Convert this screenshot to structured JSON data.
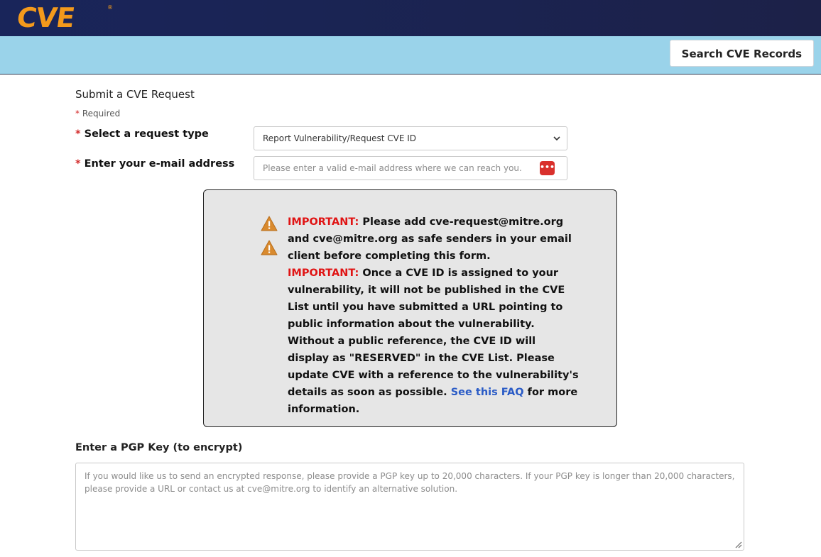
{
  "header": {
    "logo_text": "CVE",
    "logo_mark": "®",
    "brand_color": "#f39a1c",
    "search_button_label": "Search CVE Records"
  },
  "form": {
    "title": "Submit a CVE Request",
    "required_mark": "*",
    "required_note": "Required",
    "request_type": {
      "label": "Select a request type",
      "selected_value": "Report Vulnerability/Request CVE ID"
    },
    "email": {
      "label": "Enter your e-mail address",
      "placeholder": "Please enter a valid e-mail address where we can reach you.",
      "value": ""
    }
  },
  "notice": {
    "icon": "warning-icon",
    "important_label_1": "IMPORTANT:",
    "text_1": "Please add cve-request@mitre.org and cve@mitre.org as safe senders in your email client before completing this form.",
    "important_label_2": "IMPORTANT:",
    "text_2": "Once a CVE ID is assigned to your vulnerability, it will not be published in the CVE List until you have submitted a URL pointing to public information about the vulnerability. Without a public reference, the CVE ID will display as \"RESERVED\" in the CVE List. Please update CVE with a reference to the vulnerability's details as soon as possible.",
    "faq_link_label": "See this FAQ",
    "text_3": "for more information."
  },
  "pgp": {
    "label": "Enter a PGP Key (to encrypt)",
    "placeholder": "If you would like us to send an encrypted response, please provide a PGP key up to 20,000 characters. If your PGP key is longer than 20,000 characters, please provide a URL or contact us at cve@mitre.org to identify an alternative solution.",
    "value": ""
  }
}
